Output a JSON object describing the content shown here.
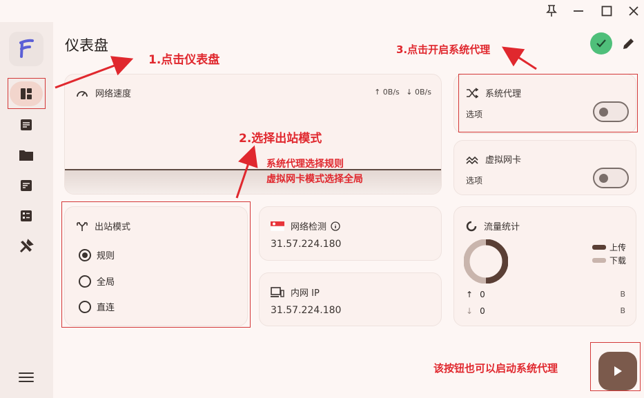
{
  "page": {
    "title": "仪表盘"
  },
  "network_speed": {
    "title": "网络速度",
    "upload": "↑ 0B/s",
    "download": "↓ 0B/s"
  },
  "system_proxy": {
    "title": "系统代理",
    "option_label": "选项",
    "enabled": false
  },
  "tun": {
    "title": "虚拟网卡",
    "option_label": "选项",
    "enabled": false
  },
  "outbound": {
    "title": "出站模式",
    "options": [
      "规则",
      "全局",
      "直连"
    ],
    "selected": "规则"
  },
  "network_check": {
    "title": "网络检测",
    "value": "31.57.224.180"
  },
  "lan_ip": {
    "title": "内网 IP",
    "value": "31.57.224.180"
  },
  "traffic": {
    "title": "流量统计",
    "legend_up": "上传",
    "legend_down": "下载",
    "up_value": "0",
    "down_value": "0",
    "up_unit": "B",
    "down_unit": "B"
  },
  "annotations": {
    "step1": "1.点击仪表盘",
    "step2": "2.选择出站模式",
    "step2_note1": "系统代理选择规则",
    "step2_note2": "虚拟网卡模式选择全局",
    "step3": "3.点击开启系统代理",
    "play_note": "该按钮也可以启动系统代理"
  },
  "colors": {
    "accent": "#7b5a4c",
    "success": "#4fbf7a",
    "annotation": "#e0282e",
    "chart_upload": "#5a3f35",
    "chart_download": "#c9b5ad"
  },
  "icons": {
    "nav": [
      "dashboard-icon",
      "article-icon",
      "folder-icon",
      "rules-icon",
      "checklist-icon",
      "tools-icon"
    ]
  }
}
